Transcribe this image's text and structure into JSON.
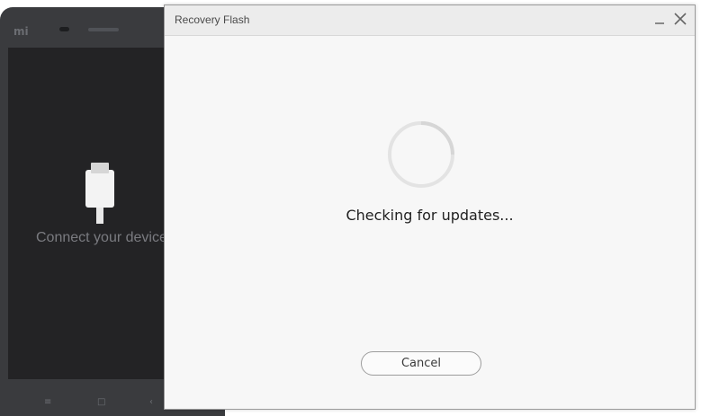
{
  "phone": {
    "brand_logo_text": "mi",
    "connect_text": "Connect your device",
    "nav_keys": {
      "menu": "≡",
      "home": "□",
      "back": "‹"
    }
  },
  "dialog": {
    "title": "Recovery Flash",
    "controls": {
      "minimize": "minimize-icon",
      "close": "close-icon"
    },
    "status_text": "Checking for updates...",
    "cancel_label": "Cancel",
    "spinner_icon": "loading-spinner-icon"
  },
  "colors": {
    "phone_body": "#3a3b3e",
    "phone_screen": "#232325",
    "dialog_bg": "#f7f7f7",
    "titlebar_bg": "#ececec",
    "spinner_ring": "#e3e3e3"
  }
}
